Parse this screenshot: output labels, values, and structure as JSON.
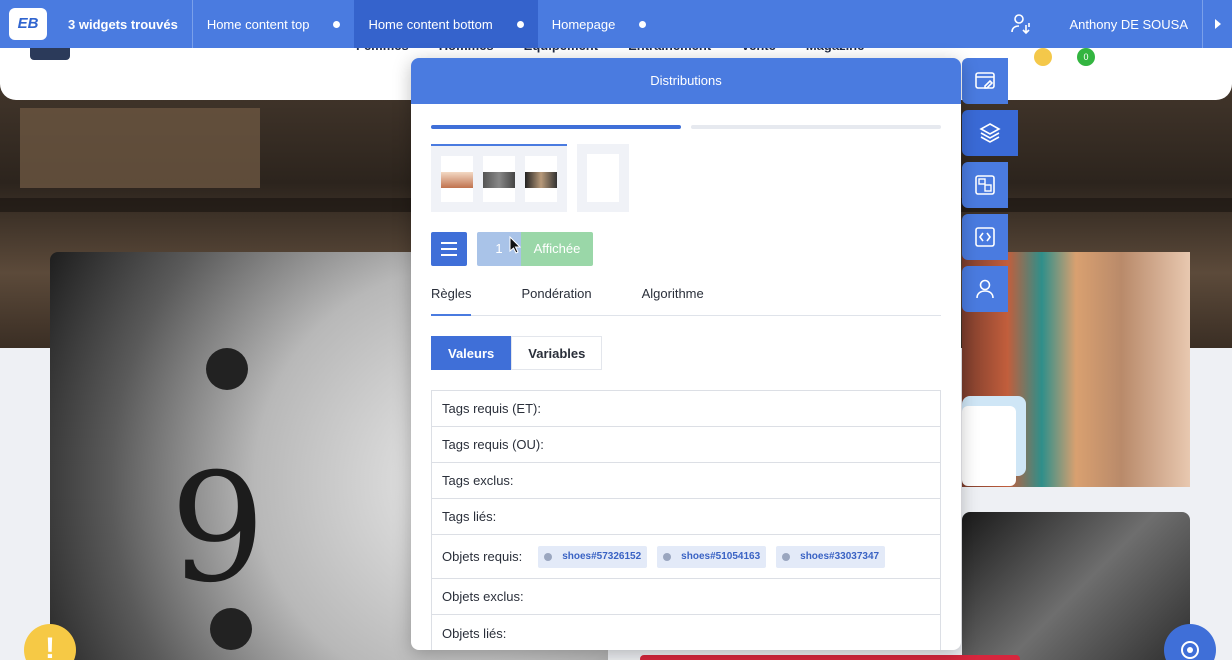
{
  "toolbar": {
    "logo_text": "EB",
    "widget_count": "3 widgets trouvés",
    "tabs": [
      {
        "label": "Home content top"
      },
      {
        "label": "Home content bottom"
      },
      {
        "label": "Homepage"
      }
    ],
    "user_name": "Anthony DE SOUSA",
    "accent_color": "#4a7be0",
    "active_tab_color": "#3563cc"
  },
  "site": {
    "nav": [
      "Femmes",
      "Hommes",
      "Equipement",
      "Entraînement",
      "Vente",
      "Magazine"
    ],
    "badge_cart": "0",
    "clock_numeral": "9",
    "fab_warning": "!"
  },
  "panel": {
    "title": "Distributions",
    "status_number": "1",
    "status_label": "Affichée",
    "tabs": [
      {
        "label": "Règles"
      },
      {
        "label": "Pondération"
      },
      {
        "label": "Algorithme"
      }
    ],
    "segments": [
      {
        "label": "Valeurs"
      },
      {
        "label": "Variables"
      }
    ],
    "rules": [
      {
        "label": "Tags requis (ET):"
      },
      {
        "label": "Tags requis (OU):"
      },
      {
        "label": "Tags exclus:"
      },
      {
        "label": "Tags liés:"
      },
      {
        "label": "Objets requis:"
      },
      {
        "label": "Objets exclus:"
      },
      {
        "label": "Objets liés:"
      }
    ],
    "required_objects": [
      "shoes#57326152",
      "shoes#51054163",
      "shoes#33037347"
    ]
  },
  "sidebar_icons": [
    "pencil-window-icon",
    "layers-icon",
    "template-icon",
    "code-icon",
    "user-icon"
  ]
}
